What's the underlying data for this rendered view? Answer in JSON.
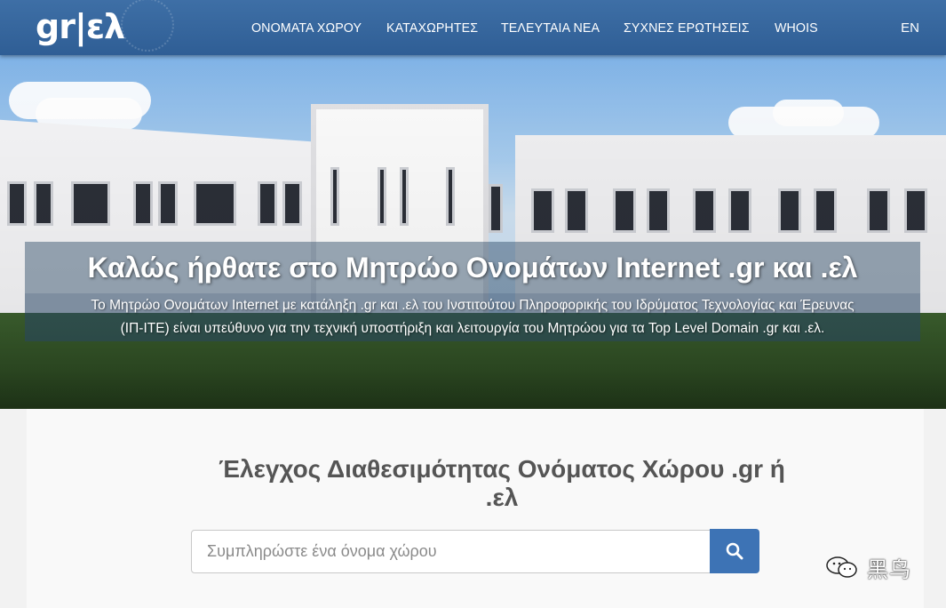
{
  "header": {
    "logo_text": "gr|ελ",
    "nav": [
      "ΟΝΟΜΑΤΑ ΧΩΡΟΥ",
      "ΚΑΤΑΧΩΡΗΤΕΣ",
      "ΤΕΛΕΥΤΑΙΑ ΝΕΑ",
      "ΣΥΧΝΕΣ ΕΡΩΤΗΣΕΙΣ",
      "WHOIS"
    ],
    "language": "EN"
  },
  "hero": {
    "title": "Καλώς ήρθατε στο Μητρώο Ονομάτων Internet .gr και .ελ",
    "subtitle_line1": "Το Μητρώο Ονομάτων Internet με κατάληξη .gr και .ελ του Ινστιτούτου Πληροφορικής του Ιδρύματος Τεχνολογίας και Έρευνας",
    "subtitle_line2": "(ΙΠ-ΙΤΕ) είναι υπεύθυνο για την τεχνική υποστήριξη και λειτουργία του Μητρώου για τα Top Level Domain .gr και .ελ."
  },
  "search": {
    "title_line1": "Έλεγχος Διαθεσιμότητας Ονόματος Χώρου .gr ή",
    "title_line2": ".ελ",
    "placeholder": "Συμπληρώστε ένα όνομα χώρου",
    "button_icon": "search-icon"
  },
  "watermark": {
    "text": "黑鸟"
  },
  "colors": {
    "navbar": "#3e6fa6",
    "search_button": "#3d73b5",
    "panel_background": "#f9f9f9"
  }
}
